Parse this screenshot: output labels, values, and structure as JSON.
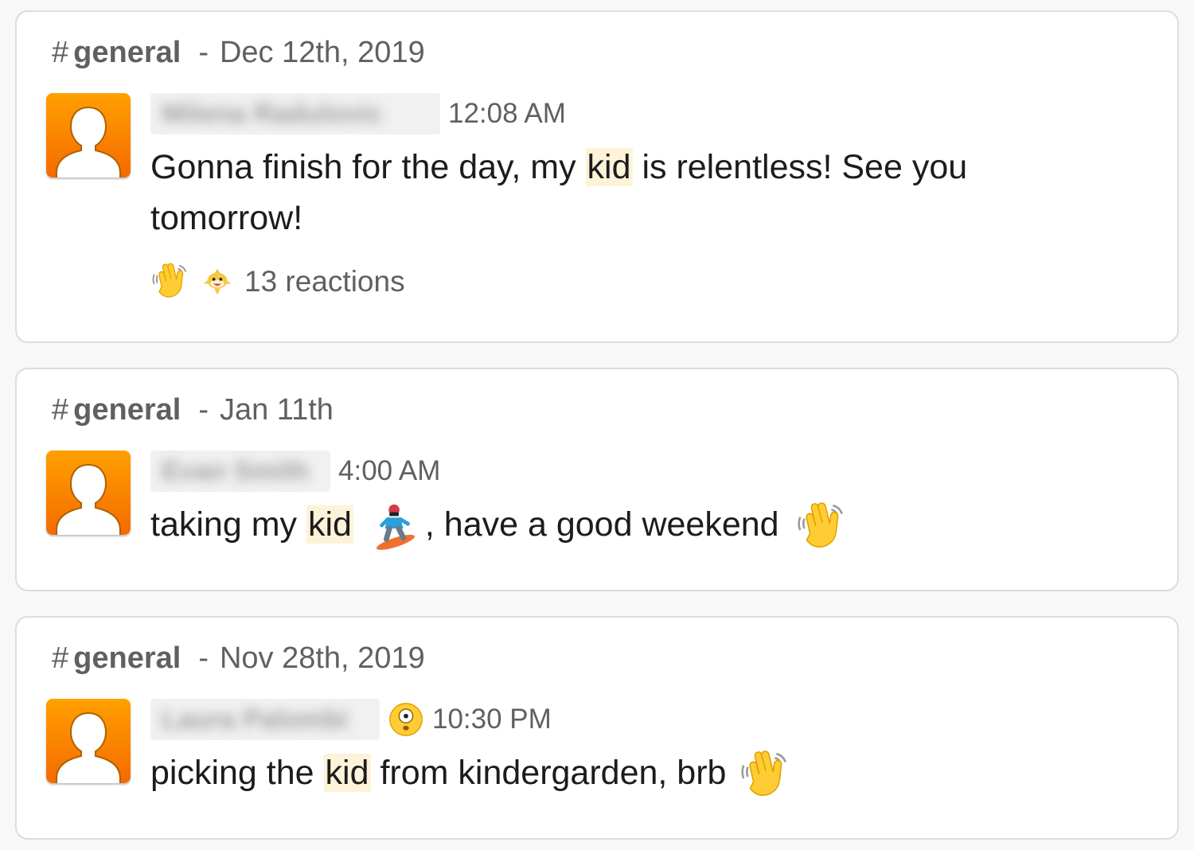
{
  "results": [
    {
      "channel_hash": "#",
      "channel": "general",
      "separator": "-",
      "date": "Dec 12th, 2019",
      "sender": "Milena Radulovic",
      "time": "12:08 AM",
      "message": {
        "before": "Gonna finish for the day, my ",
        "highlight": "kid",
        "line1_after": " is relentless! See you",
        "line2": "tomorrow!"
      },
      "reactions": {
        "emojis": [
          "waving-hand-emoji",
          "baby-shark-emoji"
        ],
        "label": "13 reactions"
      }
    },
    {
      "channel_hash": "#",
      "channel": "general",
      "separator": "-",
      "date": "Jan 11th",
      "sender": "Evan Smith",
      "time": "4:00 AM",
      "message": {
        "before": "taking my ",
        "highlight": "kid",
        "middle": ", have a good weekend",
        "emojis": [
          "snowboarder-emoji",
          "waving-hand-emoji"
        ]
      }
    },
    {
      "channel_hash": "#",
      "channel": "general",
      "separator": "-",
      "date": "Nov 28th, 2019",
      "sender": "Laura Palombi",
      "status_emoji": "dizzy-face-emoji",
      "time": "10:30 PM",
      "message": {
        "before": "picking the ",
        "highlight": "kid",
        "after": " from kindergarden, brb",
        "emojis": [
          "waving-hand-emoji"
        ]
      }
    }
  ],
  "colors": {
    "highlight": "#fdf3d8",
    "avatar_top": "#ffa000",
    "avatar_bottom": "#f56a00",
    "muted_text": "#616061"
  }
}
